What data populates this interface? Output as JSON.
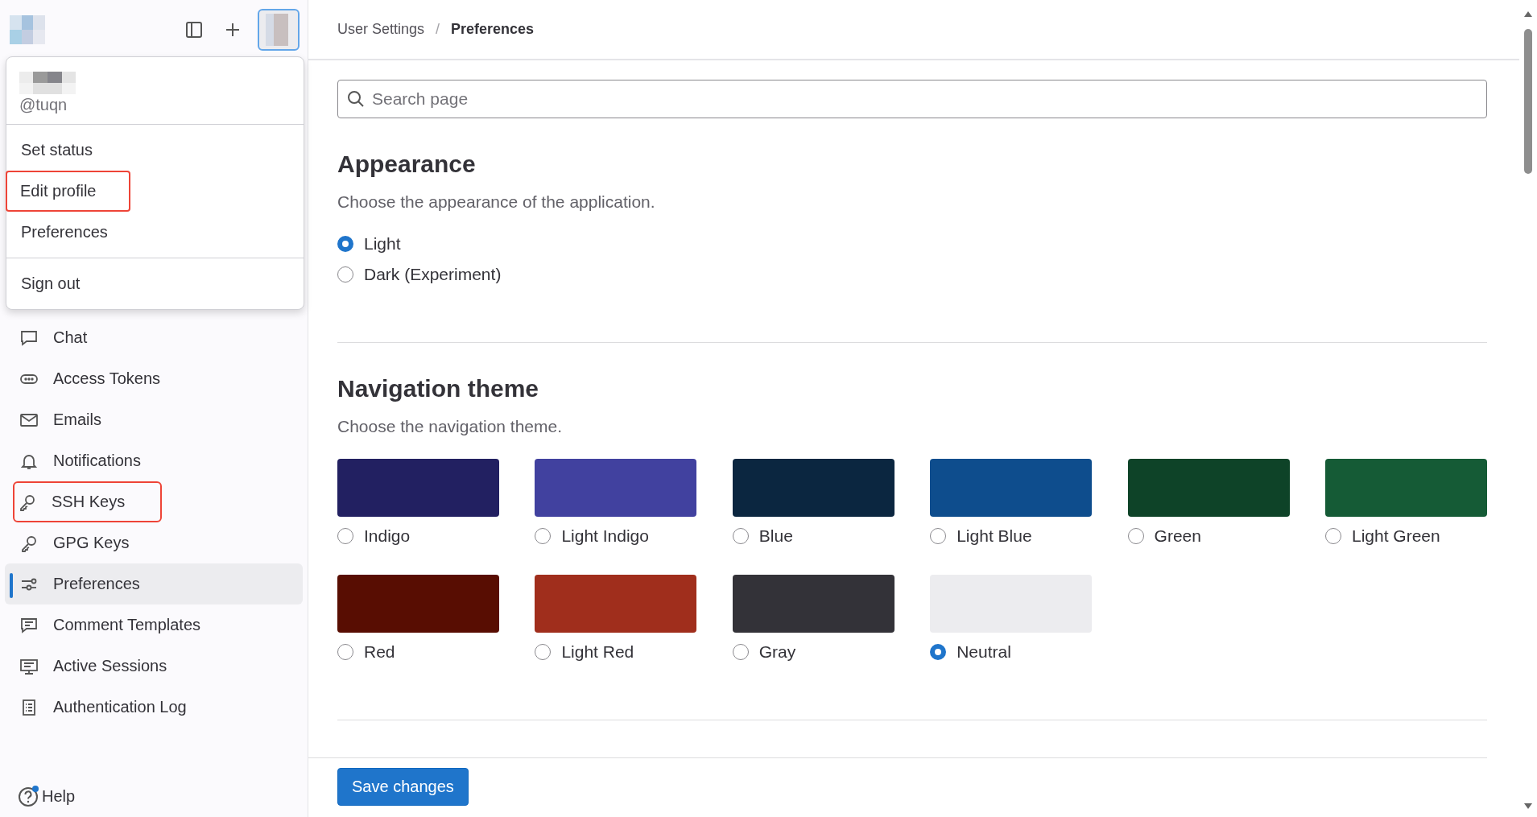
{
  "user_menu": {
    "username": "@tuqn",
    "groups": [
      [
        {
          "label": "Set status",
          "highlighted": false
        },
        {
          "label": "Edit profile",
          "highlighted": true
        },
        {
          "label": "Preferences",
          "highlighted": false
        }
      ],
      [
        {
          "label": "Sign out",
          "highlighted": false
        }
      ]
    ]
  },
  "sidebar": {
    "items": [
      {
        "label": "Chat",
        "selected": false,
        "highlighted": false
      },
      {
        "label": "Access Tokens",
        "selected": false,
        "highlighted": false
      },
      {
        "label": "Emails",
        "selected": false,
        "highlighted": false
      },
      {
        "label": "Notifications",
        "selected": false,
        "highlighted": false
      },
      {
        "label": "SSH Keys",
        "selected": false,
        "highlighted": true
      },
      {
        "label": "GPG Keys",
        "selected": false,
        "highlighted": false
      },
      {
        "label": "Preferences",
        "selected": true,
        "highlighted": false
      },
      {
        "label": "Comment Templates",
        "selected": false,
        "highlighted": false
      },
      {
        "label": "Active Sessions",
        "selected": false,
        "highlighted": false
      },
      {
        "label": "Authentication Log",
        "selected": false,
        "highlighted": false
      }
    ],
    "help": "Help"
  },
  "breadcrumb": {
    "items": [
      "User Settings",
      "Preferences"
    ],
    "separator": "/"
  },
  "search": {
    "placeholder": "Search page"
  },
  "appearance": {
    "title": "Appearance",
    "description": "Choose the appearance of the application.",
    "options": [
      {
        "label": "Light",
        "selected": true
      },
      {
        "label": "Dark (Experiment)",
        "selected": false
      }
    ]
  },
  "navigation_theme": {
    "title": "Navigation theme",
    "description": "Choose the navigation theme.",
    "themes": [
      {
        "label": "Indigo",
        "color": "#222061",
        "selected": false
      },
      {
        "label": "Light Indigo",
        "color": "#41419f",
        "selected": false
      },
      {
        "label": "Blue",
        "color": "#0b2640",
        "selected": false
      },
      {
        "label": "Light Blue",
        "color": "#0e4d8d",
        "selected": false
      },
      {
        "label": "Green",
        "color": "#0e4328",
        "selected": false
      },
      {
        "label": "Light Green",
        "color": "#155b36",
        "selected": false
      },
      {
        "label": "Red",
        "color": "#580d02",
        "selected": false
      },
      {
        "label": "Light Red",
        "color": "#a02e1c",
        "selected": false
      },
      {
        "label": "Gray",
        "color": "#333238",
        "selected": false
      },
      {
        "label": "Neutral",
        "color": "#ececef",
        "selected": true
      }
    ]
  },
  "save_button": "Save changes"
}
